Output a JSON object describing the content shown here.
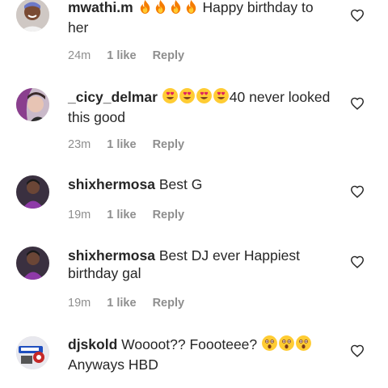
{
  "comments": [
    {
      "username": "mwathi.m",
      "emoji": "fire",
      "emoji_count": 4,
      "text": " Happy birthday to her",
      "time": "24m",
      "likes": "1 like",
      "reply": "Reply",
      "avatar": "avatar-smiling-person"
    },
    {
      "username": "_cicy_delmar",
      "emoji": "heart-eyes",
      "emoji_count": 4,
      "text": "40 never looked this good",
      "time": "23m",
      "likes": "1 like",
      "reply": "Reply",
      "avatar": "avatar-woman-purple-hair"
    },
    {
      "username": "shixhermosa",
      "emoji": "",
      "emoji_count": 0,
      "text": "Best G",
      "time": "19m",
      "likes": "1 like",
      "reply": "Reply",
      "avatar": "avatar-woman-purple-top"
    },
    {
      "username": "shixhermosa",
      "emoji": "",
      "emoji_count": 0,
      "text": "Best DJ ever Happiest birthday gal",
      "time": "19m",
      "likes": "1 like",
      "reply": "Reply",
      "avatar": "avatar-woman-purple-top"
    },
    {
      "username": "djskold",
      "emoji": "",
      "emoji_count": 0,
      "text": "Woooot?? Foooteee? ",
      "text_after_emoji": "Anyways HBD",
      "emoji_trailing": "astonished",
      "emoji_trailing_count": 3,
      "avatar": "avatar-logo"
    }
  ],
  "icons": {
    "like": "heart-outline-icon",
    "fire": "fire-emoji",
    "heart_eyes": "heart-eyes-emoji",
    "astonished": "astonished-emoji"
  },
  "colors": {
    "text": "#262626",
    "meta": "#8e8e8e",
    "heart_outline": "#262626"
  }
}
